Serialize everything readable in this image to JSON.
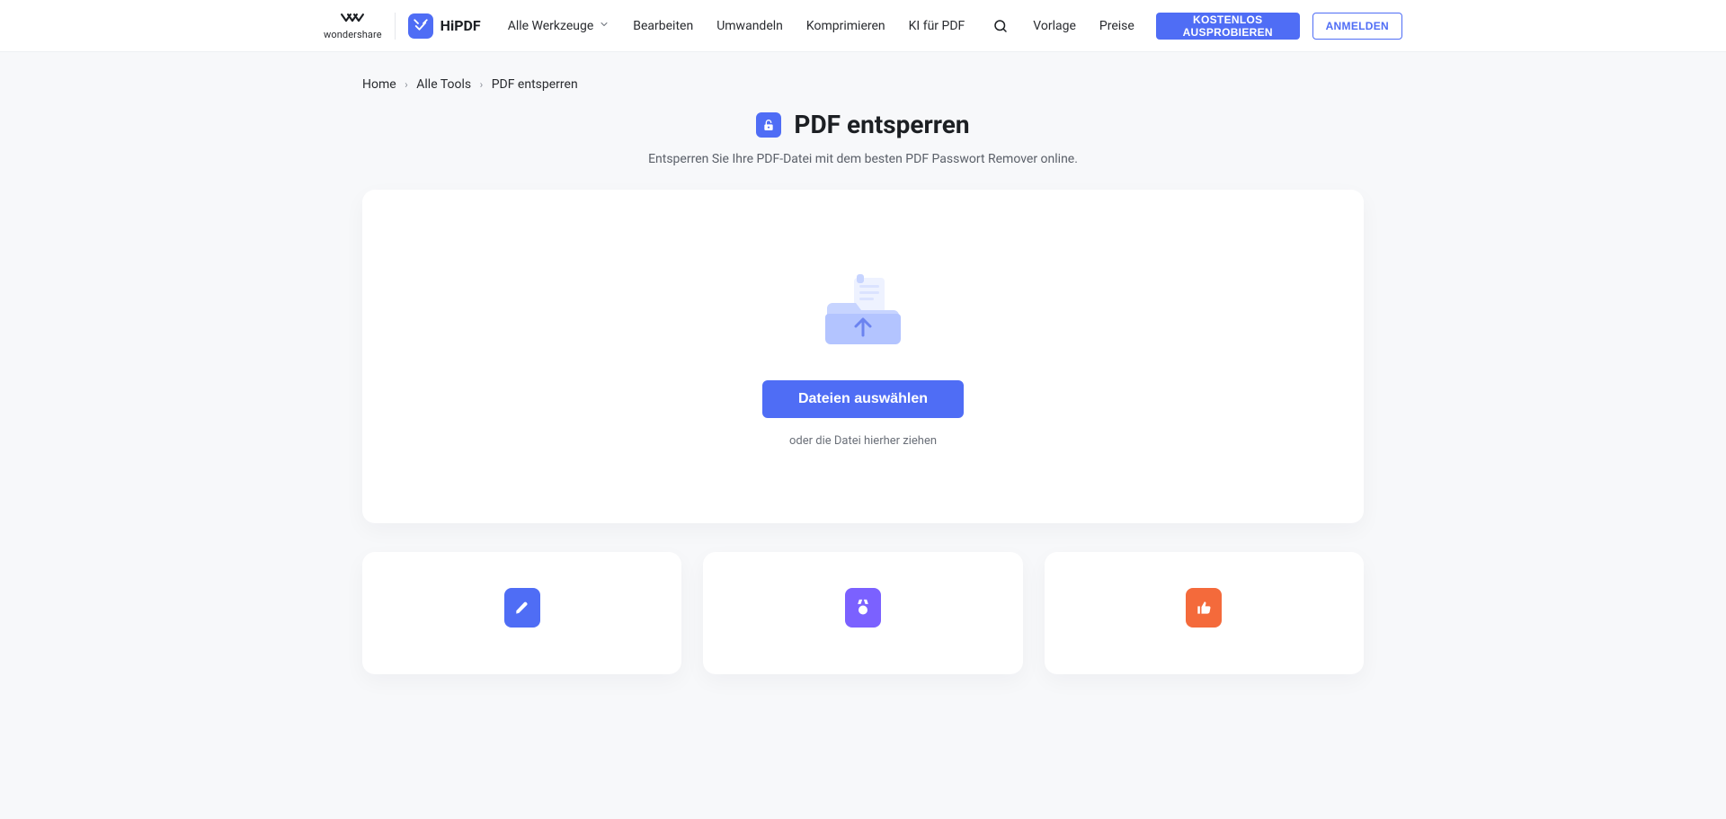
{
  "brand": {
    "wondershare": "wondershare",
    "hipdf": "HiPDF"
  },
  "nav": {
    "all_tools": "Alle Werkzeuge",
    "edit": "Bearbeiten",
    "convert": "Umwandeln",
    "compress": "Komprimieren",
    "ai_pdf": "KI für PDF",
    "template": "Vorlage",
    "pricing": "Preise"
  },
  "header_actions": {
    "try_free": "KOSTENLOS AUSPROBIEREN",
    "login": "ANMELDEN"
  },
  "breadcrumb": {
    "home": "Home",
    "all_tools": "Alle Tools",
    "current": "PDF entsperren"
  },
  "hero": {
    "title": "PDF entsperren",
    "subtitle": "Entsperren Sie Ihre PDF-Datei mit dem besten PDF Passwort Remover online."
  },
  "upload": {
    "select_button": "Dateien auswählen",
    "drag_hint": "oder die Datei hierher ziehen"
  }
}
